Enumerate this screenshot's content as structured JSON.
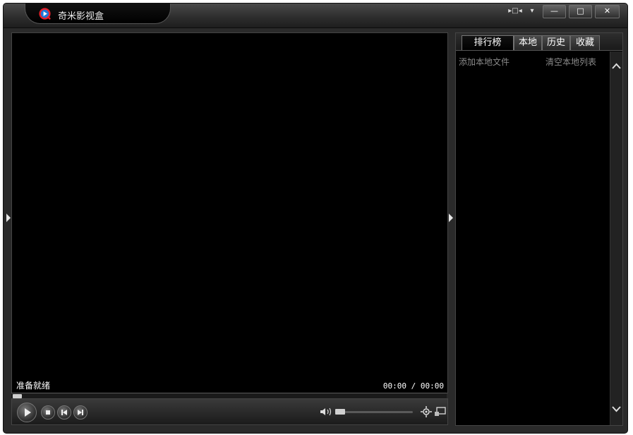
{
  "window": {
    "title": "奇米影视盒",
    "controls": {
      "mini_mode_label": "▸□◂",
      "menu_label": "▾",
      "minimize_label": "—",
      "maximize_label": "□",
      "close_label": "✕"
    }
  },
  "player": {
    "status": "准备就绪",
    "time": "00:00 / 00:00",
    "progress": 0,
    "volume": 0
  },
  "sidebar": {
    "tabs": [
      {
        "label": "排行榜",
        "active": true
      },
      {
        "label": "本地",
        "active": false
      },
      {
        "label": "历史",
        "active": false
      },
      {
        "label": "收藏",
        "active": false
      }
    ],
    "links": {
      "add_local": "添加本地文件",
      "clear_local": "清空本地列表"
    }
  },
  "icons": {
    "logo": "qvod-logo-icon",
    "play": "play-icon",
    "stop": "stop-icon",
    "previous": "previous-icon",
    "next": "next-icon",
    "volume": "volume-icon",
    "settings": "settings-icon",
    "screenshot": "screenshot-icon",
    "expand_left": "expand-left-arrow-icon",
    "expand_sidebar": "expand-sidebar-arrow-icon",
    "scroll_up": "chevron-up-icon",
    "scroll_down": "chevron-down-icon"
  },
  "colors": {
    "logo_red": "#e8202a",
    "logo_blue": "#1e78d8",
    "background": "#000000",
    "chrome": "#2a2a2a"
  }
}
